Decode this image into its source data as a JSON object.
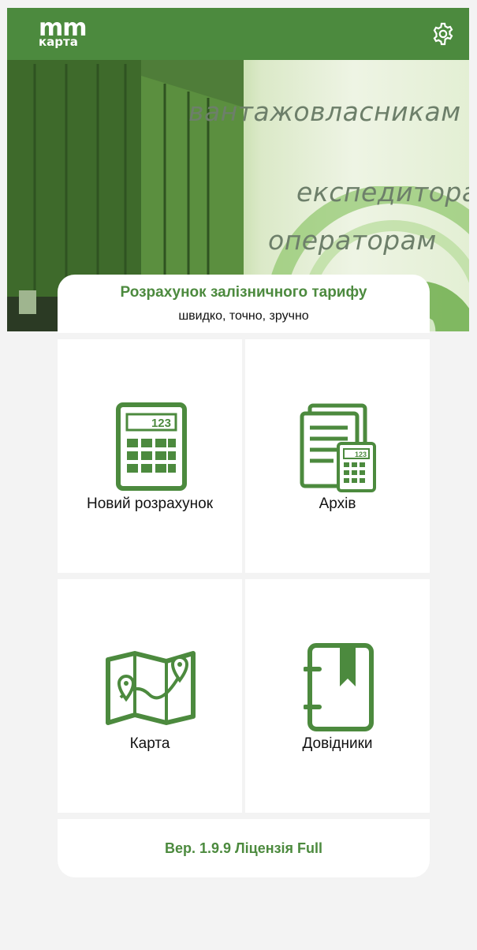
{
  "header": {
    "logo_top": "mm",
    "logo_bottom": "карта",
    "settings_icon": "gear-icon"
  },
  "banner": {
    "line1": "вантажовласникам",
    "line2": "експедиторам",
    "line3": "операторам"
  },
  "intro": {
    "title": "Розрахунок залізничного тарифу",
    "subtitle": "швидко, точно, зручно"
  },
  "tiles": [
    {
      "label": "Новий розрахунок",
      "icon": "calculator-icon",
      "display": "123"
    },
    {
      "label": "Архів",
      "icon": "archive-icon",
      "display": "123"
    },
    {
      "label": "Карта",
      "icon": "map-icon"
    },
    {
      "label": "Довідники",
      "icon": "directory-icon"
    }
  ],
  "footer": {
    "version": "Вер. 1.9.9 Ліцензія Full"
  },
  "colors": {
    "brand": "#4c8a3e",
    "tile_bg": "#ffffff",
    "page_bg": "#f3f3f3"
  }
}
